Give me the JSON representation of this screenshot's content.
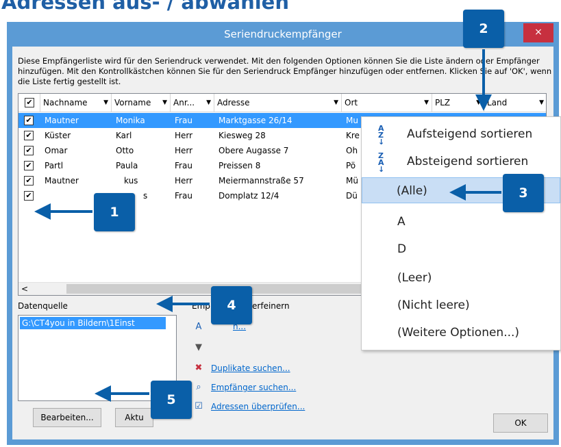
{
  "heading": "Adressen aus- / abwählen",
  "window": {
    "title": "Seriendruckempfänger",
    "close": "×"
  },
  "description": "Diese Empfängerliste wird für den Seriendruck verwendet. Mit den folgenden Optionen können Sie die Liste ändern oder Empfänger hinzufügen. Mit den Kontrollkästchen können Sie für den Seriendruck Empfänger hinzufügen oder entfernen. Klicken Sie auf 'OK', wenn die Liste fertig gestellt ist.",
  "table": {
    "columns": [
      "Nachname",
      "Vorname",
      "Anr...",
      "Adresse",
      "Ort",
      "PLZ",
      "Land"
    ],
    "rows": [
      {
        "checked": true,
        "nachname": "Mautner",
        "vorname": "Monika",
        "anrede": "Frau",
        "adresse": "Marktgasse 26/14",
        "ort": "Mu"
      },
      {
        "checked": true,
        "nachname": "Küster",
        "vorname": "Karl",
        "anrede": "Herr",
        "adresse": "Kiesweg 28",
        "ort": "Kre"
      },
      {
        "checked": true,
        "nachname": "Omar",
        "vorname": "Otto",
        "anrede": "Herr",
        "adresse": "Obere Augasse 7",
        "ort": "Oh"
      },
      {
        "checked": true,
        "nachname": "Partl",
        "vorname": "Paula",
        "anrede": "Frau",
        "adresse": "Preissen 8",
        "ort": "Pö"
      },
      {
        "checked": true,
        "nachname": "Mautner",
        "vorname": "kus",
        "anrede": "Herr",
        "adresse": "Meiermannstraße 57",
        "ort": "Mü"
      },
      {
        "checked": true,
        "nachname": "",
        "vorname": "s",
        "anrede": "Frau",
        "adresse": "Domplatz 12/4",
        "ort": "Dü"
      }
    ],
    "scroll_left": "<"
  },
  "datasource": {
    "label": "Datenquelle",
    "item": "G:\\CT4you in Bildern\\1Einst"
  },
  "refine": {
    "label": "Emp          te verfeinern",
    "links": [
      "n...",
      "",
      "Duplikate suchen...",
      "Empfänger suchen...",
      "Adressen überprüfen..."
    ]
  },
  "buttons": {
    "edit": "Bearbeiten...",
    "refresh": "Aktu",
    "ok": "OK"
  },
  "menu": {
    "items": [
      {
        "label": "Aufsteigend sortieren",
        "icon": "sort-asc-icon",
        "glyph": "A\nZ"
      },
      {
        "label": "Absteigend sortieren",
        "icon": "sort-desc-icon",
        "glyph": "Z\nA"
      },
      {
        "label": "(Alle)"
      },
      {
        "label": "A"
      },
      {
        "label": "D"
      },
      {
        "label": "(Leer)"
      },
      {
        "label": "(Nicht leere)"
      },
      {
        "label": "(Weitere Optionen...)"
      }
    ]
  },
  "badges": [
    "1",
    "2",
    "3",
    "4",
    "5"
  ],
  "colors": {
    "accent": "#0a5fa8",
    "selection": "#3399ff",
    "titlebar": "#5b9bd5",
    "close": "#c7303f"
  }
}
